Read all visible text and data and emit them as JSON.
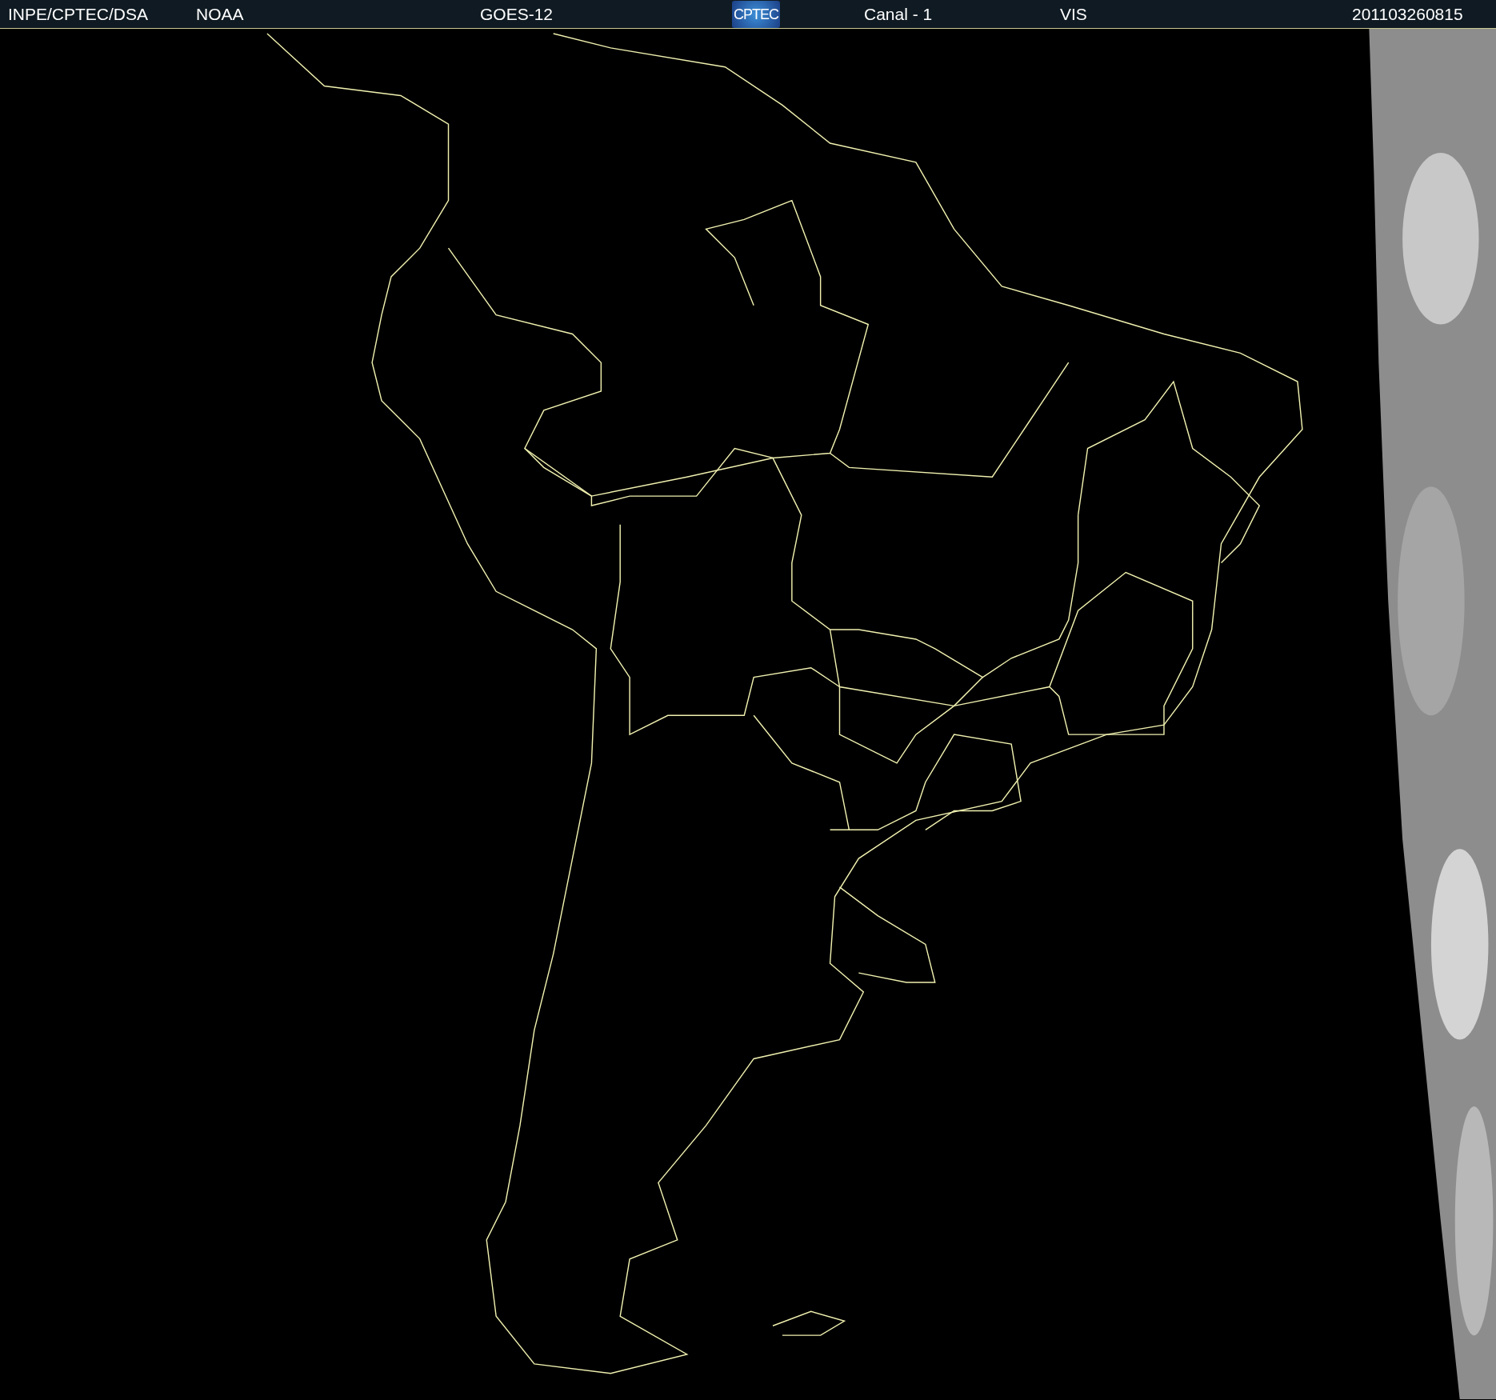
{
  "header": {
    "source": "INPE/CPTEC/DSA",
    "agency": "NOAA",
    "satellite": "GOES-12",
    "logo": "CPTEC",
    "channel": "Canal - 1",
    "band": "VIS",
    "timestamp": "201103260815"
  }
}
